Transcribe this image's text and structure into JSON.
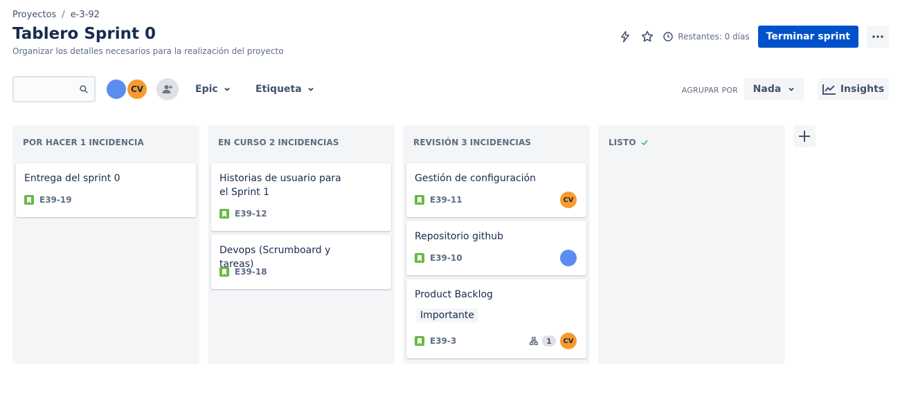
{
  "breadcrumb": {
    "root": "Proyectos",
    "separator": "/",
    "project": "e-3-92"
  },
  "header": {
    "title": "Tablero Sprint 0",
    "subtitle": "Organizar los detalles necesarios para la realización del proyecto",
    "remaining": "Restantes: 0 días",
    "complete_sprint": "Terminar sprint",
    "icons": [
      "lightning-icon",
      "star-icon",
      "clock-icon",
      "more-icon"
    ]
  },
  "toolbar": {
    "search_placeholder": "",
    "avatars": [
      {
        "initials": "",
        "color": "#5b8def"
      },
      {
        "initials": "CV",
        "color": "#f79b2e"
      }
    ],
    "filter_epic": "Epic",
    "filter_label": "Etiqueta",
    "group_by_label": "AGRUPAR POR",
    "group_by_value": "Nada",
    "insights": "Insights"
  },
  "columns": [
    {
      "name": "POR HACER",
      "count": "1",
      "unit": "INCIDENCIA",
      "cards": [
        {
          "title": "Entrega del sprint 0",
          "key": "E39-19"
        }
      ]
    },
    {
      "name": "EN CURSO",
      "count": "2",
      "unit": "INCIDENCIAS",
      "cards": [
        {
          "title": "Historias de usuario para el Sprint 1",
          "key": "E39-12"
        },
        {
          "title": "Devops (Scrumboard y tareas)",
          "key": "E39-18"
        }
      ]
    },
    {
      "name": "REVISIÓN",
      "count": "3",
      "unit": "INCIDENCIAS",
      "cards": [
        {
          "title": "Gestión de configuración",
          "key": "E39-11",
          "assignee": "CV"
        },
        {
          "title": "Repositorio github",
          "key": "E39-10",
          "assignee": ""
        },
        {
          "title": "Product Backlog",
          "key": "E39-3",
          "label": "Importante",
          "subtasks": "1",
          "assignee": "CV"
        }
      ]
    },
    {
      "name": "LISTO",
      "count": "",
      "unit": "",
      "cards": []
    }
  ],
  "colors": {
    "primary": "#0052cc",
    "story": "#65ba43",
    "done_check": "#36b37e"
  }
}
